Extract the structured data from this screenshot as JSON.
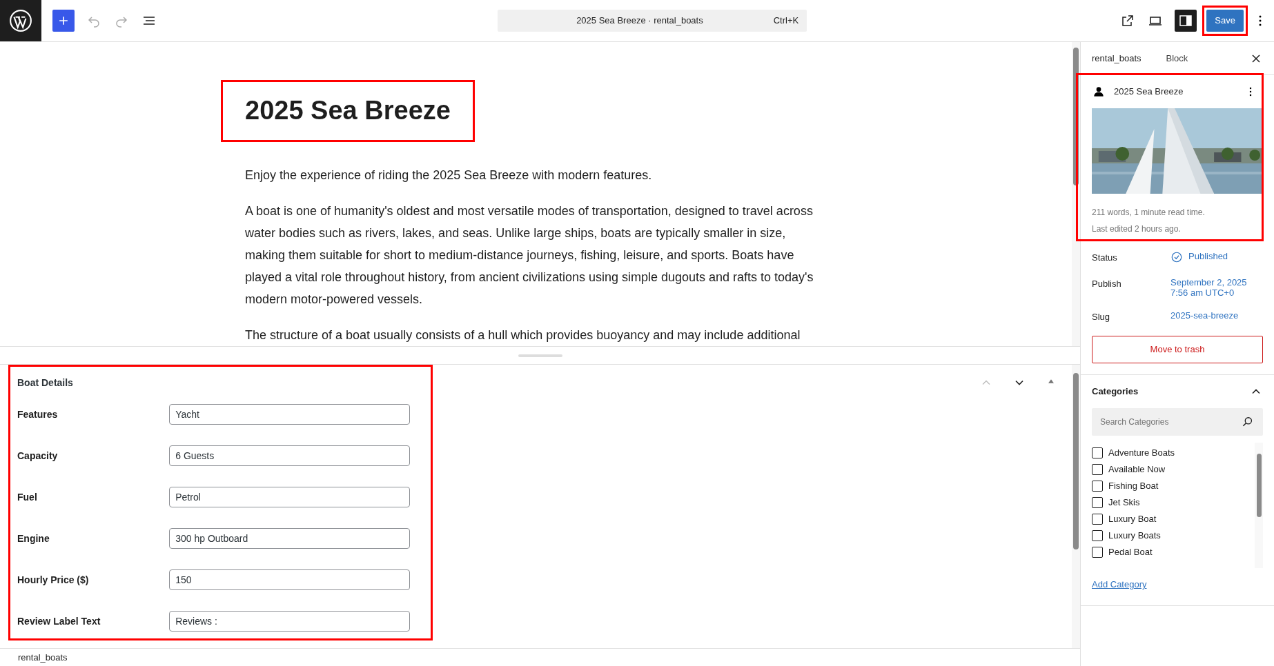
{
  "topbar": {
    "document_title": "2025 Sea Breeze · rental_boats",
    "shortcut": "Ctrl+K",
    "save_button": "Save",
    "sidebar_toggle_on": true
  },
  "post": {
    "title": "2025 Sea Breeze",
    "paragraphs": [
      "Enjoy the experience of riding the 2025 Sea Breeze with modern features.",
      "A boat is one of humanity's oldest and most versatile modes of transportation, designed to travel across water bodies such as rivers, lakes, and seas. Unlike large ships, boats are typically smaller in size, making them suitable for short to medium-distance journeys, fishing, leisure, and sports. Boats have played a vital role throughout history, from ancient civilizations using simple dugouts and rafts to today's modern motor-powered vessels.",
      "The structure of a boat usually consists of a hull which provides buoyancy and may include additional"
    ]
  },
  "meta_box": {
    "title": "Boat Details",
    "fields": [
      {
        "label": "Features",
        "value": "Yacht"
      },
      {
        "label": "Capacity",
        "value": "6 Guests"
      },
      {
        "label": "Fuel",
        "value": "Petrol"
      },
      {
        "label": "Engine",
        "value": "300 hp Outboard"
      },
      {
        "label": "Hourly Price ($)",
        "value": "150"
      },
      {
        "label": "Review Label Text",
        "value": "Reviews :"
      }
    ]
  },
  "footer": {
    "breadcrumb": "rental_boats"
  },
  "sidebar": {
    "tabs": [
      {
        "label": "rental_boats",
        "selected": true
      },
      {
        "label": "Block",
        "selected": false
      }
    ],
    "summary": {
      "title": "2025 Sea Breeze",
      "stats": "211 words, 1 minute read time.",
      "last_edited": "Last edited 2 hours ago."
    },
    "rows": [
      {
        "label": "Status",
        "value": "Published"
      },
      {
        "label": "Publish",
        "value": "September 2, 2025\n7:56 am UTC+0"
      },
      {
        "label": "Slug",
        "value": "2025-sea-breeze"
      }
    ],
    "trash_button": "Move to trash",
    "categories": {
      "title": "Categories",
      "expanded": true,
      "search_placeholder": "Search Categories",
      "items": [
        {
          "label": "Adventure Boats",
          "checked": false
        },
        {
          "label": "Available Now",
          "checked": false
        },
        {
          "label": "Fishing Boat",
          "checked": false
        },
        {
          "label": "Jet Skis",
          "checked": false
        },
        {
          "label": "Luxury Boat",
          "checked": false
        },
        {
          "label": "Luxury Boats",
          "checked": false
        },
        {
          "label": "Pedal Boat",
          "checked": false
        }
      ],
      "add_link": "Add Category"
    }
  }
}
